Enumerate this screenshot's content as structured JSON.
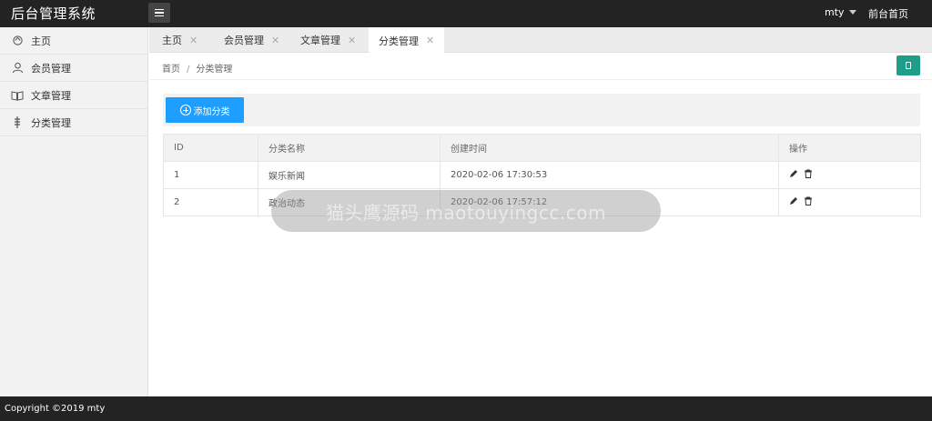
{
  "header": {
    "title": "后台管理系统",
    "user_name": "mty",
    "front_link": "前台首页"
  },
  "sidebar": {
    "items": [
      {
        "label": "主页",
        "icon": "home-icon"
      },
      {
        "label": "会员管理",
        "icon": "user-icon"
      },
      {
        "label": "文章管理",
        "icon": "book-icon"
      },
      {
        "label": "分类管理",
        "icon": "category-icon"
      }
    ]
  },
  "tabs": [
    {
      "label": "主页",
      "close": "✕"
    },
    {
      "label": "会员管理",
      "close": "✕"
    },
    {
      "label": "文章管理",
      "close": "✕"
    },
    {
      "label": "分类管理",
      "close": "✕",
      "active": true
    }
  ],
  "breadcrumb": {
    "home": "首页",
    "separator": "/",
    "current": "分类管理"
  },
  "toolbar": {
    "add_label": "添加分类"
  },
  "table": {
    "columns": [
      "ID",
      "分类名称",
      "创建时间",
      "操作"
    ],
    "rows": [
      {
        "id": "1",
        "name": "娱乐新闻",
        "created": "2020-02-06 17:30:53"
      },
      {
        "id": "2",
        "name": "政治动态",
        "created": "2020-02-06 17:57:12"
      }
    ]
  },
  "watermark": "猫头鹰源码 maotouyingcc.com",
  "footer": {
    "copyright": "Copyright ©2019 mty"
  },
  "colors": {
    "topbar": "#232323",
    "primary_button": "#1e9fff",
    "refresh_button": "#1e9e8a",
    "sidebar_bg": "#f2f2f2"
  }
}
